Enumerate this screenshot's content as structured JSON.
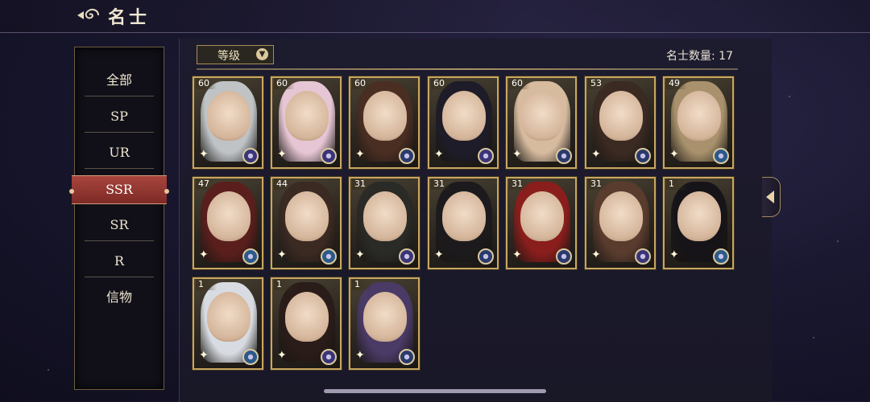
{
  "header": {
    "title": "名士"
  },
  "side_menu": {
    "items": [
      {
        "label": "全部",
        "active": false
      },
      {
        "label": "SP",
        "active": false
      },
      {
        "label": "UR",
        "active": false
      },
      {
        "label": "SSR",
        "active": true
      },
      {
        "label": "SR",
        "active": false
      },
      {
        "label": "R",
        "active": false
      },
      {
        "label": "信物",
        "active": false
      }
    ]
  },
  "toolbar": {
    "sort_label": "等级",
    "count_text": "名士数量: 17"
  },
  "cards": [
    {
      "level": "60",
      "hair": "#bfc3c6",
      "badge": "#3a3578"
    },
    {
      "level": "60",
      "hair": "#e6c6d4",
      "badge": "#3a3578"
    },
    {
      "level": "60",
      "hair": "#4a2e22",
      "badge": "#2a3a6c"
    },
    {
      "level": "60",
      "hair": "#1e1c28",
      "badge": "#3a3578"
    },
    {
      "level": "60",
      "hair": "#d7bb9f",
      "badge": "#2a3a6c"
    },
    {
      "level": "53",
      "hair": "#3a2a22",
      "badge": "#2a3a6c"
    },
    {
      "level": "49",
      "hair": "#a8916c",
      "badge": "#2b5a8a"
    },
    {
      "level": "47",
      "hair": "#5a1f1c",
      "badge": "#2b5a8a"
    },
    {
      "level": "44",
      "hair": "#3a2a22",
      "badge": "#2b5a8a"
    },
    {
      "level": "31",
      "hair": "#2a2a26",
      "badge": "#3a3578"
    },
    {
      "level": "31",
      "hair": "#1c1a1c",
      "badge": "#2a3a6c"
    },
    {
      "level": "31",
      "hair": "#8a1e1c",
      "badge": "#2a3a6c"
    },
    {
      "level": "31",
      "hair": "#5a3c2e",
      "badge": "#3a3578"
    },
    {
      "level": "1",
      "hair": "#161418",
      "badge": "#2b5a8a"
    },
    {
      "level": "1",
      "hair": "#d8dce2",
      "badge": "#2b5a8a"
    },
    {
      "level": "1",
      "hair": "#2a1c18",
      "badge": "#3a3578"
    },
    {
      "level": "1",
      "hair": "#4a3a66",
      "badge": "#2a3a6c"
    }
  ]
}
